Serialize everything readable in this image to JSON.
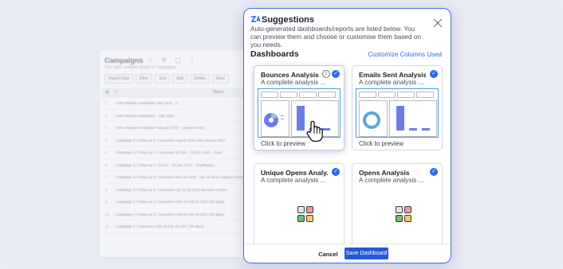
{
  "background_sheet": {
    "title": "Campaigns",
    "subtitle": "This table contains details of Campaigns",
    "toolbar": [
      "Import Data",
      "Filter",
      "Sort",
      "Add",
      "Delete",
      "More"
    ],
    "column_header": "Name",
    "rows": [
      {
        "num": "1",
        "text": "Zoho Reports Newsletter, Mar 2016 - 2"
      },
      {
        "num": "2",
        "text": "Zoho Reports Newsletter - July 2016"
      },
      {
        "num": "3",
        "text": "Zoho Reports Newsletter February 2017 - present active"
      },
      {
        "num": "4",
        "text": "Campaign 3: Follow up 5: Customers August 2016 and January 2017"
      },
      {
        "num": "5",
        "text": "Campaign 3: Follow up 1: Customers 16 Nov - 15 Dec 2016 - Goal"
      },
      {
        "num": "6",
        "text": "Campaign 3: Follow up 1: 16 Nov - 15 Dec 2016 - TrustRadius"
      },
      {
        "num": "7",
        "text": "Campaign 4: Follow up 5: Customers Nov 16 2016 - Jun 15 2016 coupon 3 months"
      },
      {
        "num": "8",
        "text": "Campaign 5: Follow up 5: Customers Apr 01 30 2016 discount months"
      },
      {
        "num": "9",
        "text": "Campaign 1: Follow up 1: Customers Feb 15-Feb 21 2017 (30 days)"
      },
      {
        "num": "10",
        "text": "Campaign 1: Follow up 2: Customers Feb 08-Feb 14 2017 (30 days)"
      },
      {
        "num": "11",
        "text": "Campaign 1: Customers Feb 23-Feb 28 2017 (30 days)"
      }
    ]
  },
  "modal": {
    "title": "Suggestions",
    "description": "Auto-generated dashboards/reports are listed below. You can preview them and choose or customise them based on you needs.",
    "section_title": "Dashboards",
    "customize_link": "Customize Columns Used",
    "cards": [
      {
        "title": "Bounces Analysis",
        "subtitle": "A complete analysis ...",
        "footer": "Click to preview"
      },
      {
        "title": "Emails Sent Analysis",
        "subtitle": "A complete analysis ...",
        "footer": "Click to preview"
      },
      {
        "title": "Unique Opens Analy...",
        "subtitle": "A complete analysis ..."
      },
      {
        "title": "Opens Analysis",
        "subtitle": "A complete analysis ..."
      }
    ],
    "cancel_label": "Cancel",
    "save_label": "Save Dashboard"
  },
  "colors": {
    "accent": "#2659d6",
    "check": "#2d6ae3",
    "modal_border": "#3d6ef0",
    "preview_border": "#4ba0d8",
    "chart_blue": "#6c7ee6",
    "icon_red": "#f09a9a",
    "icon_green": "#6fbf73",
    "icon_yellow": "#f3c86b",
    "icon_grey": "#e4e4e4"
  },
  "icons": {
    "close": "close-icon",
    "check": "check-circle-icon",
    "info": "info-icon",
    "app": "app-grid-icon",
    "cursor": "hand-cursor-icon"
  }
}
